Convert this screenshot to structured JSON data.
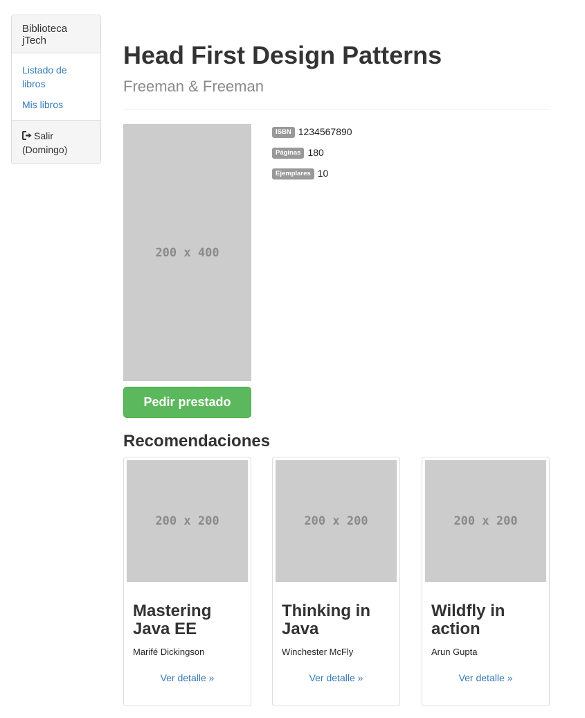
{
  "sidebar": {
    "brand": "Biblioteca jTech",
    "links": [
      "Listado de libros",
      "Mis libros"
    ],
    "logout_label": "Salir (Domingo)"
  },
  "book": {
    "title": "Head First Design Patterns",
    "author": "Freeman & Freeman",
    "cover_placeholder": "200 x 400",
    "details": [
      {
        "label": "ISBN",
        "value": "1234567890"
      },
      {
        "label": "Páginas",
        "value": "180"
      },
      {
        "label": "Ejemplares",
        "value": "10"
      }
    ],
    "borrow_label": "Pedir prestado"
  },
  "recommendations": {
    "heading": "Recomendaciones",
    "items": [
      {
        "image_placeholder": "200 x 200",
        "title": "Mastering Java EE",
        "author": "Marifé Dickingson",
        "link": "Ver detalle »"
      },
      {
        "image_placeholder": "200 x 200",
        "title": "Thinking in Java",
        "author": "Winchester McFly",
        "link": "Ver detalle »"
      },
      {
        "image_placeholder": "200 x 200",
        "title": "Wildfly in action",
        "author": "Arun Gupta",
        "link": "Ver detalle »"
      }
    ]
  },
  "colors": {
    "link": "#337ab7",
    "success": "#5cb85c",
    "label": "#999999",
    "placeholder": "#cccccc"
  },
  "icons": {
    "logout": "log-out-icon"
  }
}
